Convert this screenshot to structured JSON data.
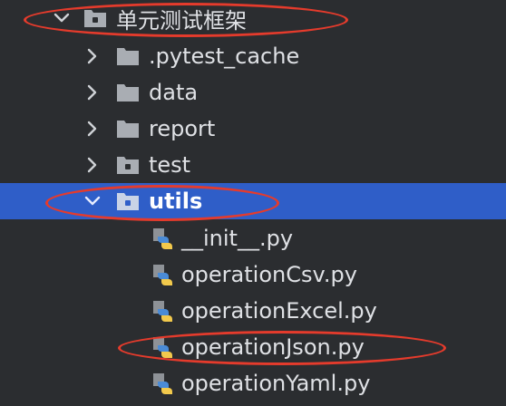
{
  "tree": {
    "root": {
      "label": "单元测试框架",
      "expanded": true
    },
    "children": [
      {
        "label": ".pytest_cache",
        "type": "folder",
        "expanded": false
      },
      {
        "label": "data",
        "type": "folder",
        "expanded": false
      },
      {
        "label": "report",
        "type": "folder",
        "expanded": false
      },
      {
        "label": "test",
        "type": "package",
        "expanded": false
      },
      {
        "label": "utils",
        "type": "package",
        "expanded": true,
        "selected": true
      }
    ],
    "utils_files": [
      {
        "label": "__init__.py"
      },
      {
        "label": "operationCsv.py"
      },
      {
        "label": "operationExcel.py"
      },
      {
        "label": "operationJson.py"
      },
      {
        "label": "operationYaml.py"
      }
    ]
  },
  "colors": {
    "background": "#2b2d30",
    "selection": "#2f5ec8",
    "annotation": "#e53b2c",
    "folder": "#a9adb3",
    "python_blue": "#4a8bd6",
    "python_yellow": "#f2c94c"
  },
  "annotations": [
    "root-highlight",
    "utils-highlight",
    "operationJson-highlight"
  ]
}
